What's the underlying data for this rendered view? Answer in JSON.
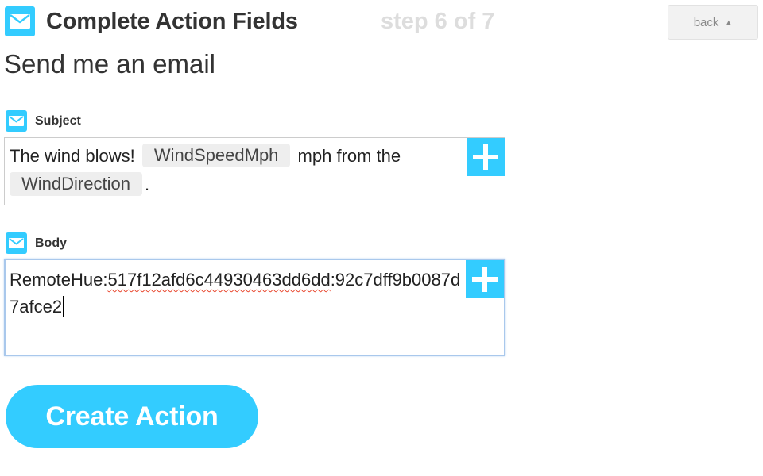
{
  "header": {
    "title": "Complete Action Fields",
    "step": "step 6 of 7",
    "back_label": "back",
    "icon": "email-envelope-icon"
  },
  "action": {
    "name": "Send me an email"
  },
  "fields": {
    "subject": {
      "label": "Subject",
      "text_1": "The wind blows!",
      "ingredient_1": "WindSpeedMph",
      "text_2": "mph from the",
      "ingredient_2": "WindDirection",
      "text_3": "."
    },
    "body": {
      "label": "Body",
      "prefix": "RemoteHue",
      "separator": ":",
      "underlined": "517f12afd6c44930463dd6dd",
      "suffix": ":92c7dff9b0087d7afce2"
    }
  },
  "footer": {
    "create_label": "Create Action"
  },
  "colors": {
    "accent": "#33ccff",
    "step_text": "#dddddd",
    "focus_border": "#a9c8ec",
    "ingredient_bg": "#eeeeee"
  }
}
